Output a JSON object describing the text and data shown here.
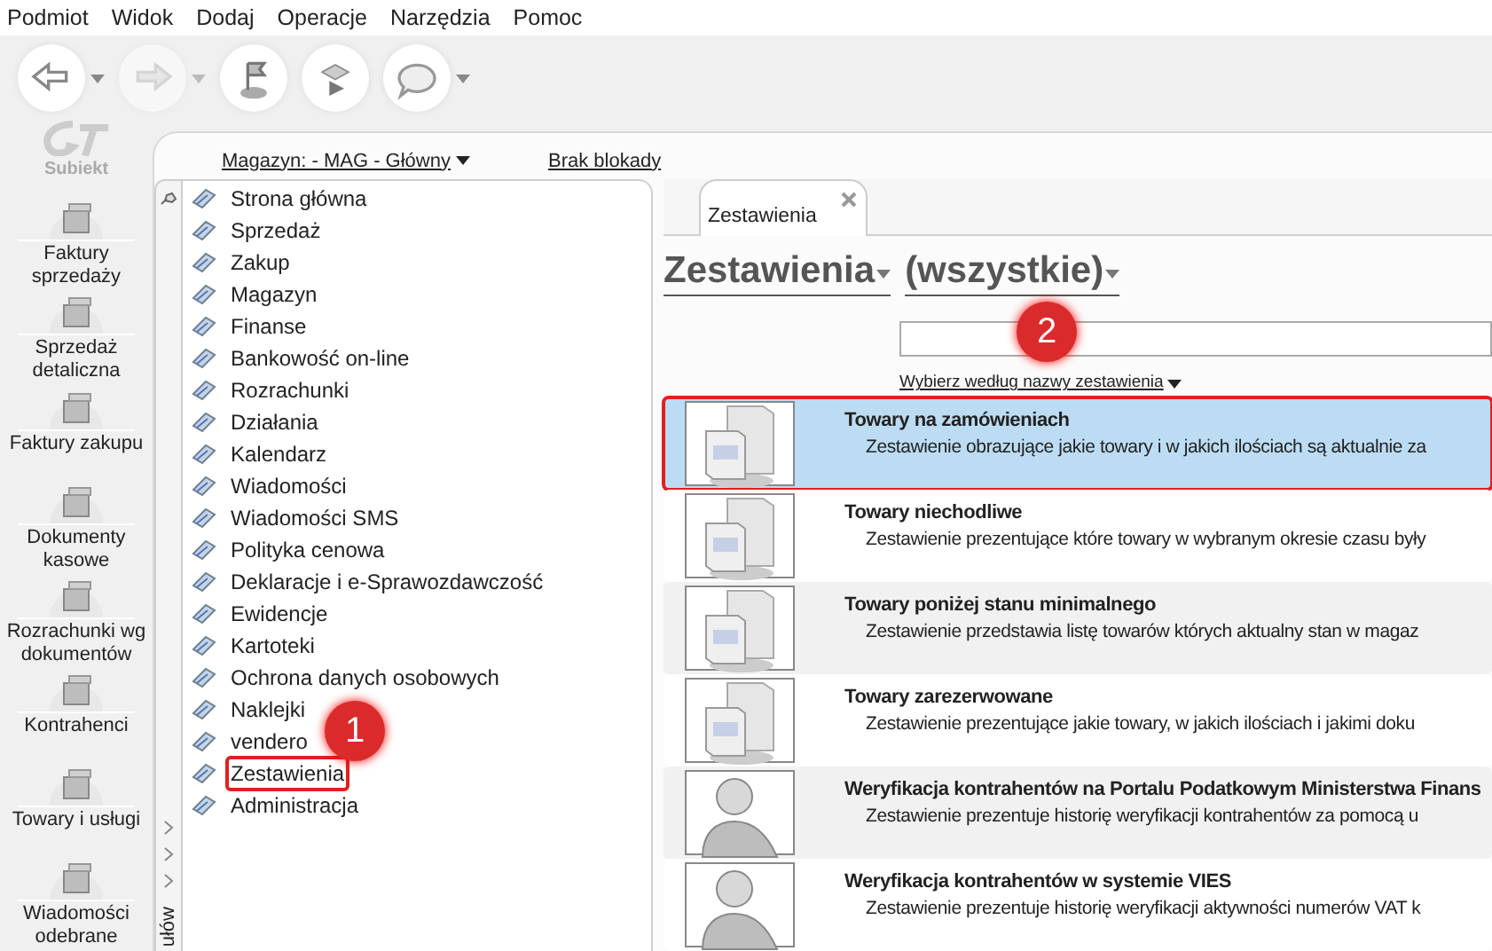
{
  "menu": [
    "Podmiot",
    "Widok",
    "Dodaj",
    "Operacje",
    "Narzędzia",
    "Pomoc"
  ],
  "toolbar": [
    {
      "kind": "back",
      "has_menu": true,
      "disabled": false
    },
    {
      "kind": "forward",
      "has_menu": true,
      "disabled": true
    },
    {
      "kind": "flag",
      "has_menu": false,
      "disabled": false
    },
    {
      "kind": "check",
      "has_menu": false,
      "disabled": false
    },
    {
      "kind": "help",
      "has_menu": true,
      "disabled": false
    }
  ],
  "logo": {
    "text": "Subiekt"
  },
  "sidebar": {
    "items": [
      {
        "label": "Faktury sprzedaży"
      },
      {
        "label": "Sprzedaż detaliczna"
      },
      {
        "label": "Faktury zakupu"
      },
      {
        "label": "Dokumenty kasowe"
      },
      {
        "label": "Rozrachunki wg dokumentów"
      },
      {
        "label": "Kontrahenci"
      },
      {
        "label": "Towary i usługi"
      },
      {
        "label": "Wiadomości odebrane"
      }
    ]
  },
  "header": {
    "warehouse_link": "Magazyn: - MAG - Główny",
    "lock_link": "Brak blokady"
  },
  "nav_strip": {
    "vertical_text": "ułów"
  },
  "nav": {
    "items": [
      {
        "label": "Strona główna",
        "highlighted": false
      },
      {
        "label": "Sprzedaż",
        "highlighted": false
      },
      {
        "label": "Zakup",
        "highlighted": false
      },
      {
        "label": "Magazyn",
        "highlighted": false
      },
      {
        "label": "Finanse",
        "highlighted": false
      },
      {
        "label": "Bankowość on-line",
        "highlighted": false
      },
      {
        "label": "Rozrachunki",
        "highlighted": false
      },
      {
        "label": "Działania",
        "highlighted": false
      },
      {
        "label": "Kalendarz",
        "highlighted": false
      },
      {
        "label": "Wiadomości",
        "highlighted": false
      },
      {
        "label": "Wiadomości SMS",
        "highlighted": false
      },
      {
        "label": "Polityka cenowa",
        "highlighted": false
      },
      {
        "label": "Deklaracje i e-Sprawozdawczość",
        "highlighted": false
      },
      {
        "label": "Ewidencje",
        "highlighted": false
      },
      {
        "label": "Kartoteki",
        "highlighted": false
      },
      {
        "label": "Ochrona danych osobowych",
        "highlighted": false
      },
      {
        "label": "Naklejki",
        "highlighted": false
      },
      {
        "label": "vendero",
        "highlighted": false
      },
      {
        "label": "Zestawienia",
        "highlighted": true
      },
      {
        "label": "Administracja",
        "highlighted": false
      }
    ]
  },
  "tabs": [
    {
      "label": "Zestawienia",
      "selected": true
    }
  ],
  "heading": {
    "category": "Zestawienia",
    "filter": "(wszystkie)"
  },
  "sort_link": "Wybierz według nazwy zestawienia",
  "reports": [
    {
      "kind": "boxes",
      "title": "Towary na zamówieniach",
      "description": "Zestawienie obrazujące jakie towary i w jakich ilościach są aktualnie za",
      "selected": true,
      "highlighted": true
    },
    {
      "kind": "boxes",
      "title": "Towary niechodliwe",
      "description": "Zestawienie prezentujące które towary w wybranym okresie czasu były",
      "selected": false,
      "highlighted": false
    },
    {
      "kind": "boxes",
      "title": "Towary poniżej stanu minimalnego",
      "description": "Zestawienie przedstawia listę towarów których aktualny stan w magaz",
      "selected": false,
      "highlighted": false
    },
    {
      "kind": "boxes",
      "title": "Towary zarezerwowane",
      "description": "Zestawienie prezentujące jakie towary, w jakich ilościach i jakimi doku",
      "selected": false,
      "highlighted": false
    },
    {
      "kind": "person",
      "title": "Weryfikacja kontrahentów na Portalu Podatkowym Ministerstwa Finans",
      "description": "Zestawienie prezentuje historię weryfikacji kontrahentów za pomocą u",
      "selected": false,
      "highlighted": false
    },
    {
      "kind": "person",
      "title": "Weryfikacja kontrahentów w systemie VIES",
      "description": "Zestawienie prezentuje historię weryfikacji aktywności numerów VAT k",
      "selected": false,
      "highlighted": false
    }
  ],
  "callouts": [
    {
      "text": "1"
    },
    {
      "text": "2"
    }
  ]
}
